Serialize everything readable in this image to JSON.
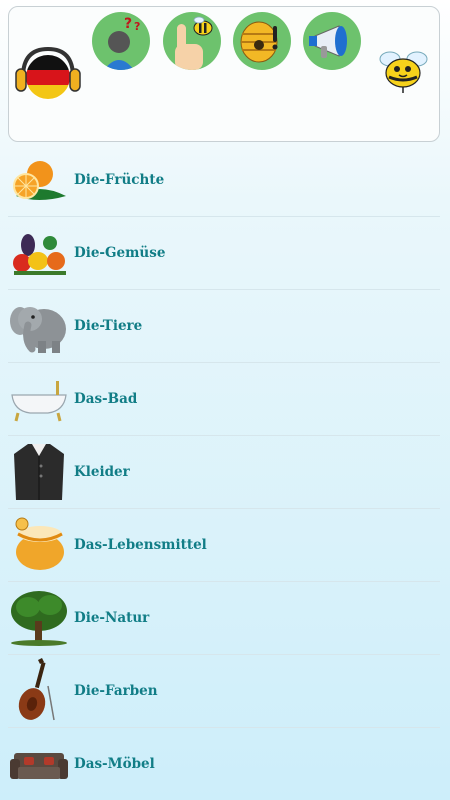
{
  "header": {
    "language_icon": "germany-flag-headphones-icon",
    "buttons": [
      {
        "name": "quiz-button",
        "icon": "question-person-icon"
      },
      {
        "name": "practice-button",
        "icon": "hand-bee-icon"
      },
      {
        "name": "hive-button",
        "icon": "beehive-icon"
      },
      {
        "name": "announce-button",
        "icon": "megaphone-icon"
      }
    ],
    "mascot_icon": "bee-icon"
  },
  "categories": [
    {
      "label": "Die-Früchte",
      "icon": "orange-icon"
    },
    {
      "label": "Die-Gemüse",
      "icon": "vegetables-icon"
    },
    {
      "label": "Die-Tiere",
      "icon": "elephant-icon"
    },
    {
      "label": "Das-Bad",
      "icon": "bathtub-icon"
    },
    {
      "label": "Kleider",
      "icon": "coat-icon"
    },
    {
      "label": "Das-Lebensmittel",
      "icon": "honey-pot-icon"
    },
    {
      "label": "Die-Natur",
      "icon": "tree-icon"
    },
    {
      "label": "Die-Farben",
      "icon": "double-bass-icon"
    },
    {
      "label": "Das-Möbel",
      "icon": "sofa-icon"
    }
  ],
  "colors": {
    "label": "#117d86",
    "circle_green": "#6dc26d",
    "divider": "#d6e6ec"
  }
}
